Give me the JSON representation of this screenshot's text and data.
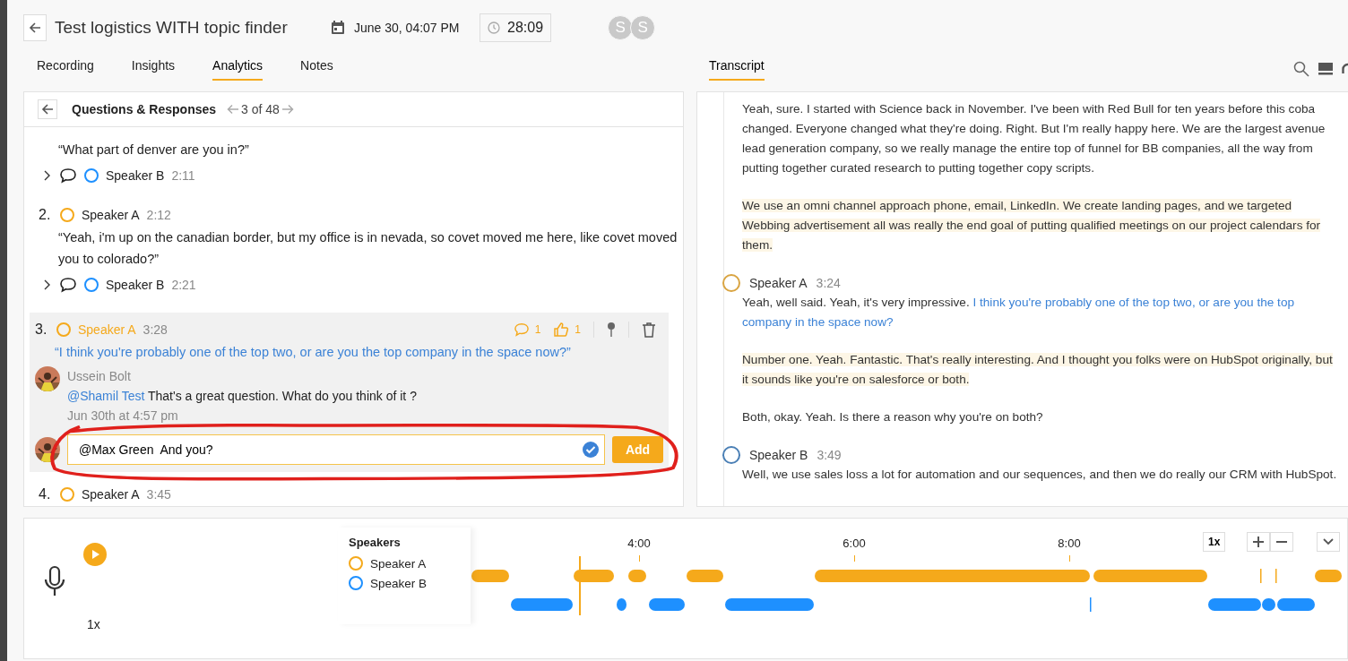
{
  "header": {
    "title": "Test logistics WITH topic finder",
    "date": "June 30, 04:07 PM",
    "duration": "28:09",
    "avatars": [
      "S",
      "S"
    ]
  },
  "tabs": [
    {
      "label": "Recording",
      "selected": false
    },
    {
      "label": "Insights",
      "selected": false
    },
    {
      "label": "Analytics",
      "selected": true
    },
    {
      "label": "Notes",
      "selected": false
    }
  ],
  "transcript_tab": {
    "label": "Transcript",
    "selected": true
  },
  "qa": {
    "title": "Questions & Responses",
    "counter": "3 of 48",
    "items": [
      {
        "kind": "partial",
        "quote": "“What part of denver are you in?”",
        "response": {
          "speaker": "Speaker B",
          "time": "2:11",
          "color": "#1e90ff"
        }
      },
      {
        "kind": "question",
        "number": "2.",
        "speaker": "Speaker A",
        "time": "2:12",
        "color": "#f5a91b",
        "selected": false,
        "quote": "“Yeah, i'm up on the canadian border, but my office is in nevada, so covet moved me here, like covet moved you to colorado?”",
        "response": {
          "speaker": "Speaker B",
          "time": "2:21",
          "color": "#1e90ff"
        }
      },
      {
        "kind": "question",
        "number": "3.",
        "speaker": "Speaker A",
        "time": "3:28",
        "color": "#f5a91b",
        "selected": true,
        "quote": "“I think you're probably one of the top two, or are you the top company in the space now?”",
        "comments": "1",
        "likes": "1",
        "comment": {
          "author": "Ussein Bolt",
          "mention": "@Shamil Test",
          "text": "That's a great question. What do you think of it ?",
          "date": "Jun 30th at 4:57 pm"
        },
        "reply": "@Max Green  And you?",
        "add": "Add"
      },
      {
        "kind": "question",
        "number": "4.",
        "speaker": "Speaker A",
        "time": "3:45",
        "color": "#f5a91b",
        "selected": false
      }
    ]
  },
  "transcript": [
    {
      "kind": "continuation",
      "paragraphs": [
        {
          "highlighted": false,
          "parts": [
            {
              "text": "Yeah, sure. I started with Science back in November. I've been with Red Bull for ten years before this coba changed. Everyone changed what they're doing. Right. But I'm really happy here. We are the largest avenue lead generation company, so we really manage the entire top of funnel for BB companies, all the way from putting together curated research to putting together copy scripts.",
              "quoted": false
            }
          ]
        },
        {
          "highlighted": true,
          "parts": [
            {
              "text": "We use an omni channel approach phone, email, LinkedIn. We create landing pages, and we targeted Webbing advertisement all was really the end goal of putting qualified meetings on our project calendars for them.",
              "quoted": false
            }
          ]
        }
      ]
    },
    {
      "kind": "speaker",
      "speaker": "Speaker A",
      "time": "3:24",
      "color": "#d9a441",
      "paragraphs": [
        {
          "highlighted": false,
          "parts": [
            {
              "text": "Yeah, well said. Yeah, it's very impressive. ",
              "quoted": false
            },
            {
              "text": "I think you're probably one of the top two, or are you the top company in the space now?",
              "quoted": true
            }
          ]
        },
        {
          "highlighted": true,
          "parts": [
            {
              "text": "Number one. Yeah. Fantastic. That's really interesting. And I thought you folks were on HubSpot originally, but it sounds like you're on salesforce or both.",
              "quoted": false
            }
          ]
        },
        {
          "highlighted": false,
          "parts": [
            {
              "text": "Both, okay. Yeah. Is there a reason why you're on both?",
              "quoted": false
            }
          ]
        }
      ]
    },
    {
      "kind": "speaker",
      "speaker": "Speaker B",
      "time": "3:49",
      "color": "#4a7fb5",
      "paragraphs": [
        {
          "highlighted": false,
          "parts": [
            {
              "text": "Well, we use sales loss a lot for automation and our sequences, and then we do really our CRM with HubSpot.",
              "quoted": false
            }
          ]
        }
      ]
    }
  ],
  "player": {
    "speed": "1x",
    "legend_title": "Speakers",
    "speakers": [
      {
        "name": "Speaker A",
        "color": "#f5a91b"
      },
      {
        "name": "Speaker B",
        "color": "#1e90ff"
      }
    ],
    "ticks": [
      "4:00",
      "6:00",
      "8:00"
    ],
    "rate_button": "1x"
  }
}
